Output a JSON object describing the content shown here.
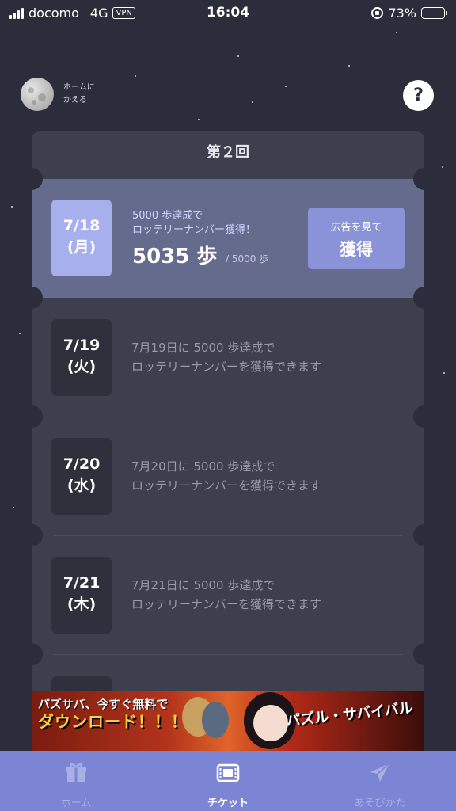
{
  "status_bar": {
    "carrier": "docomo",
    "network": "4G",
    "vpn": "VPN",
    "time": "16:04",
    "battery": "73%",
    "battery_level": 0.73
  },
  "header": {
    "home_back_label": "ホームに\nかえる",
    "help": "?"
  },
  "ticket": {
    "title": "第２回",
    "days": [
      {
        "date": "7/18",
        "weekday": "(月)",
        "active": true,
        "achieve_text": "5000 歩達成で\nロッテリーナンバー獲得！",
        "steps": "5035 歩",
        "goal": "/ 5000 歩",
        "button": {
          "line1": "広告を見て",
          "line2": "獲得"
        }
      },
      {
        "date": "7/19",
        "weekday": "(火)",
        "active": false,
        "message": "7月19日に 5000 歩達成で\nロッテリーナンバーを獲得できます"
      },
      {
        "date": "7/20",
        "weekday": "(水)",
        "active": false,
        "message": "7月20日に 5000 歩達成で\nロッテリーナンバーを獲得できます"
      },
      {
        "date": "7/21",
        "weekday": "(木)",
        "active": false,
        "message": "7月21日に 5000 歩達成で\nロッテリーナンバーを獲得できます"
      }
    ]
  },
  "banner_ad": {
    "line1": "パズサバ、今すぐ無料で",
    "line2": "ダウンロード！！！",
    "logo": "パズル・サバイバル"
  },
  "tabs": [
    {
      "label": "ホーム",
      "icon": "gift-icon",
      "active": false
    },
    {
      "label": "チケット",
      "icon": "ticket-icon",
      "active": true
    },
    {
      "label": "あそびかた",
      "icon": "paper-plane-icon",
      "active": false
    }
  ],
  "colors": {
    "background": "#2b2d3a",
    "accent": "#7c84d4",
    "active_row": "#656b8c"
  }
}
